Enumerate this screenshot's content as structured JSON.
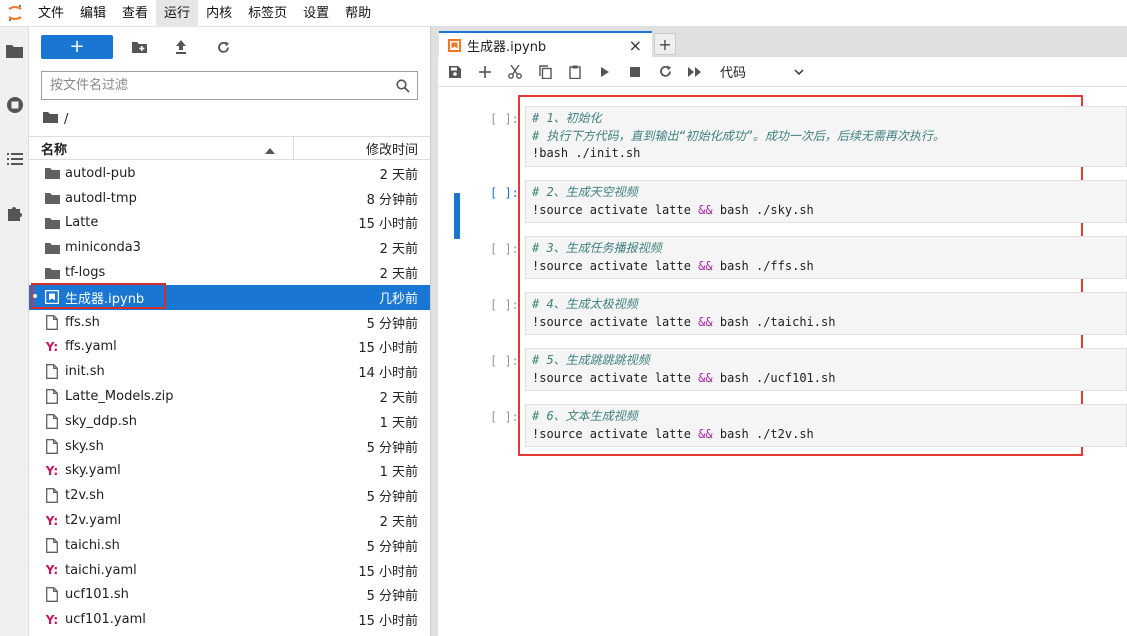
{
  "menu": [
    "文件",
    "编辑",
    "查看",
    "运行",
    "内核",
    "标签页",
    "设置",
    "帮助"
  ],
  "menu_active_index": 3,
  "filebrowser": {
    "new_label": "+",
    "search_placeholder": "按文件名过滤",
    "path": "/",
    "col_name": "名称",
    "col_modified": "修改时间",
    "files": [
      {
        "name": "autodl-pub",
        "type": "folder",
        "modified": "2 天前"
      },
      {
        "name": "autodl-tmp",
        "type": "folder",
        "modified": "8 分钟前"
      },
      {
        "name": "Latte",
        "type": "folder",
        "modified": "15 小时前"
      },
      {
        "name": "miniconda3",
        "type": "folder",
        "modified": "2 天前"
      },
      {
        "name": "tf-logs",
        "type": "folder",
        "modified": "2 天前"
      },
      {
        "name": "生成器.ipynb",
        "type": "notebook",
        "modified": "几秒前",
        "selected": true
      },
      {
        "name": "ffs.sh",
        "type": "file",
        "modified": "5 分钟前"
      },
      {
        "name": "ffs.yaml",
        "type": "yaml",
        "modified": "15 小时前"
      },
      {
        "name": "init.sh",
        "type": "file",
        "modified": "14 小时前"
      },
      {
        "name": "Latte_Models.zip",
        "type": "file",
        "modified": "2 天前"
      },
      {
        "name": "sky_ddp.sh",
        "type": "file",
        "modified": "1 天前"
      },
      {
        "name": "sky.sh",
        "type": "file",
        "modified": "5 分钟前"
      },
      {
        "name": "sky.yaml",
        "type": "yaml",
        "modified": "1 天前"
      },
      {
        "name": "t2v.sh",
        "type": "file",
        "modified": "5 分钟前"
      },
      {
        "name": "t2v.yaml",
        "type": "yaml",
        "modified": "2 天前"
      },
      {
        "name": "taichi.sh",
        "type": "file",
        "modified": "5 分钟前"
      },
      {
        "name": "taichi.yaml",
        "type": "yaml",
        "modified": "15 小时前"
      },
      {
        "name": "ucf101.sh",
        "type": "file",
        "modified": "5 分钟前"
      },
      {
        "name": "ucf101.yaml",
        "type": "yaml",
        "modified": "15 小时前"
      }
    ]
  },
  "tab": {
    "label": "生成器.ipynb",
    "close": "×",
    "add": "+"
  },
  "toolbar": {
    "cell_type": "代码"
  },
  "cells": [
    {
      "prompt": "[ ]:",
      "lines": [
        {
          "t": "cmt",
          "text": "# 1、初始化"
        },
        {
          "t": "cmt",
          "text": "# 执行下方代码，直到输出“初始化成功”。成功一次后，后续无需再次执行。"
        },
        {
          "t": "plain",
          "text": "!bash ./init.sh"
        }
      ]
    },
    {
      "prompt": "[ ]:",
      "active": true,
      "lines": [
        {
          "t": "cmt",
          "text": "# 2、生成天空视频"
        },
        {
          "t": "cmd",
          "pre": "!source activate latte ",
          "op": "&&",
          "post": " bash ./sky.sh"
        }
      ]
    },
    {
      "prompt": "[ ]:",
      "lines": [
        {
          "t": "cmt",
          "text": "# 3、生成任务播报视频"
        },
        {
          "t": "cmd",
          "pre": "!source activate latte ",
          "op": "&&",
          "post": " bash ./ffs.sh"
        }
      ]
    },
    {
      "prompt": "[ ]:",
      "lines": [
        {
          "t": "cmt",
          "text": "# 4、生成太极视频"
        },
        {
          "t": "cmd",
          "pre": "!source activate latte ",
          "op": "&&",
          "post": " bash ./taichi.sh"
        }
      ]
    },
    {
      "prompt": "[ ]:",
      "lines": [
        {
          "t": "cmt",
          "text": "# 5、生成跳跳跳视频"
        },
        {
          "t": "cmd",
          "pre": "!source activate latte ",
          "op": "&&",
          "post": " bash ./ucf101.sh"
        }
      ]
    },
    {
      "prompt": "[ ]:",
      "lines": [
        {
          "t": "cmt",
          "text": "# 6、文本生成视频"
        },
        {
          "t": "cmd",
          "pre": "!source activate latte ",
          "op": "&&",
          "post": " bash ./t2v.sh"
        }
      ]
    }
  ],
  "colors": {
    "accent": "#1976d2",
    "highlight": "#e53935",
    "comment": "#408080",
    "operator": "#a626a4",
    "yaml": "#c2185b"
  }
}
